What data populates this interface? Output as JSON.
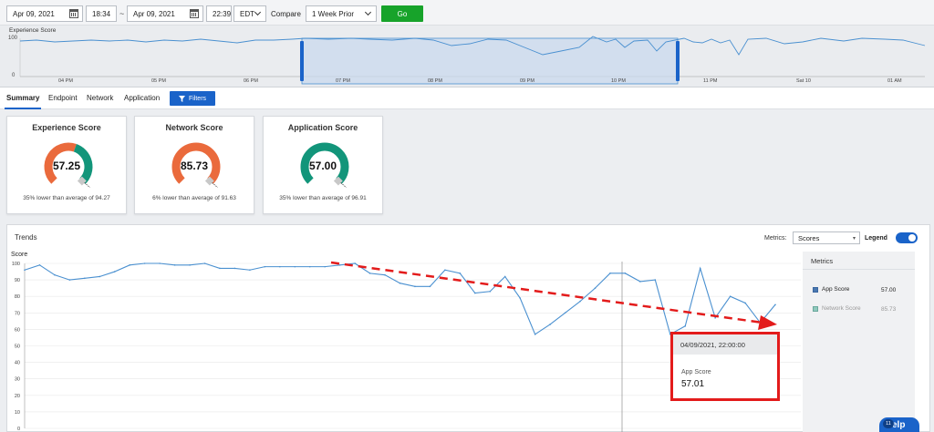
{
  "filter_bar": {
    "start_date": "Apr 09, 2021",
    "start_time": "18:34",
    "separator": "~",
    "end_date": "Apr 09, 2021",
    "end_time": "22:39",
    "timezone": "EDT",
    "compare_label": "Compare",
    "compare_value": "1 Week Prior",
    "go_label": "Go"
  },
  "timeline": {
    "title": "Experience Score",
    "y_max_label": "100",
    "y_min_label": "0",
    "ticks": [
      "04 PM",
      "05 PM",
      "06 PM",
      "07 PM",
      "08 PM",
      "09 PM",
      "10 PM",
      "11 PM",
      "Sat 10",
      "01 AM"
    ]
  },
  "tabs": [
    "Summary",
    "Endpoint",
    "Network",
    "Application"
  ],
  "filters_label": "Filters",
  "cards": [
    {
      "title": "Experience Score",
      "value": "57.25",
      "score": 57.25,
      "note": "35% lower than average of 94.27"
    },
    {
      "title": "Network Score",
      "value": "85.73",
      "score": 85.73,
      "note": "6% lower than average of 91.63"
    },
    {
      "title": "Application Score",
      "value": "57.00",
      "score": 57.0,
      "note": "35% lower than average of 96.91"
    }
  ],
  "trends": {
    "title": "Trends",
    "metrics_label": "Metrics:",
    "metrics_value": "Scores",
    "legend_label": "Legend",
    "y_title": "Score",
    "y_ticks": [
      "100",
      "90",
      "80",
      "70",
      "60",
      "50",
      "40",
      "30",
      "20",
      "10",
      "0"
    ]
  },
  "side_panel": {
    "title": "Metrics",
    "items": [
      {
        "label": "App Score",
        "value": "57.00"
      },
      {
        "label": "Network Score",
        "value": "85.73"
      }
    ]
  },
  "tooltip": {
    "timestamp": "04/09/2021, 22:00:00",
    "label": "App Score",
    "value": "57.01"
  },
  "help_label": "elp",
  "help_badge": "11",
  "colors": {
    "accent": "#1a63c9",
    "go": "#17a32a",
    "gauge_good": "#12957a",
    "gauge_bad": "#ea6a3c",
    "line": "#4a90d0",
    "highlight": "#e31b1b"
  },
  "chart_data": {
    "type": "line",
    "ylabel": "Score",
    "ylim": [
      0,
      100
    ],
    "series": [
      {
        "name": "App Score",
        "values": [
          96,
          99,
          93,
          90,
          91,
          92,
          95,
          99,
          100,
          100,
          99,
          99,
          100,
          97,
          97,
          96,
          98,
          98,
          98,
          98,
          98,
          99,
          100,
          94,
          93,
          88,
          86,
          86,
          96,
          94,
          82,
          83,
          92,
          79,
          57,
          63,
          70,
          77,
          85,
          94,
          94,
          89,
          90,
          57,
          62,
          97,
          67,
          80,
          76,
          64,
          75
        ]
      }
    ]
  }
}
